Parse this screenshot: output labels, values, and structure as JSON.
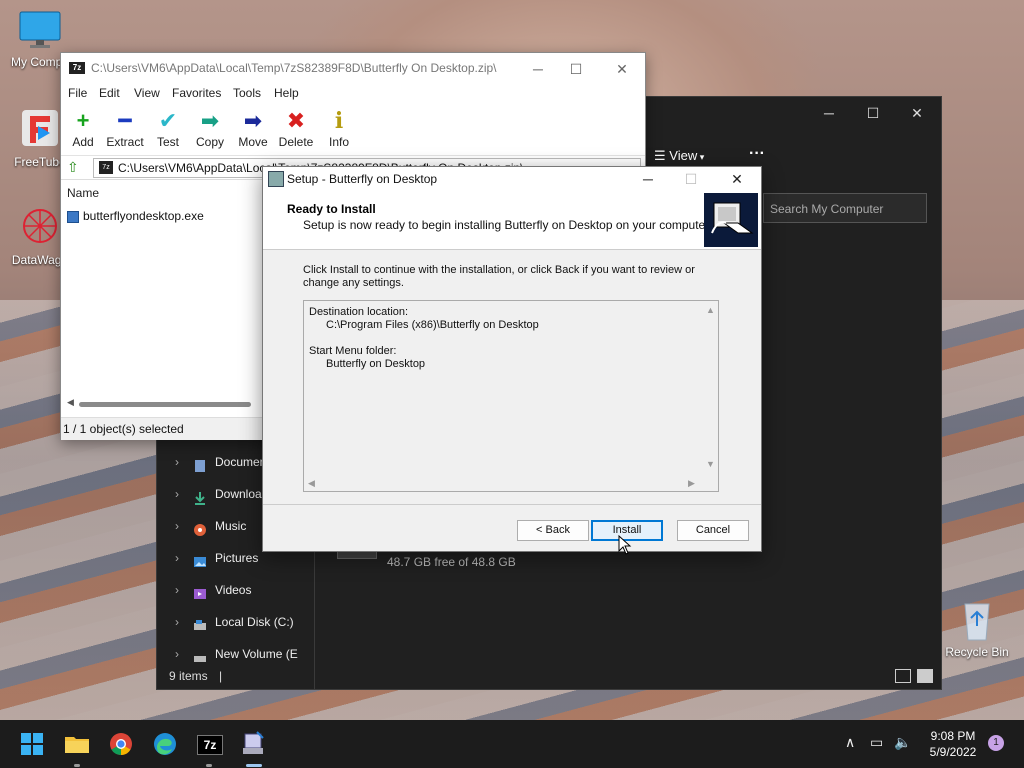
{
  "desktop": {
    "icons": [
      {
        "label": "My Compu"
      },
      {
        "label": "FreeTube"
      },
      {
        "label": "DataWago"
      }
    ],
    "recycle_bin": "Recycle Bin"
  },
  "explorer": {
    "view_label": "View",
    "more_label": "···",
    "search_placeholder": "Search My Computer",
    "sidebar": [
      {
        "label": "Documen"
      },
      {
        "label": "Downloa"
      },
      {
        "label": "Music"
      },
      {
        "label": "Pictures"
      },
      {
        "label": "Videos"
      },
      {
        "label": "Local Disk (C:)"
      },
      {
        "label": "New Volume (E"
      }
    ],
    "disk_free": "48.7 GB free of 48.8 GB",
    "status": "9 items",
    "colors": {
      "bg": "#202020"
    }
  },
  "zip": {
    "logo": "7z",
    "title": "C:\\Users\\VM6\\AppData\\Local\\Temp\\7zS82389F8D\\Butterfly On Desktop.zip\\",
    "menu": [
      "File",
      "Edit",
      "View",
      "Favorites",
      "Tools",
      "Help"
    ],
    "tools": [
      {
        "label": "Add",
        "icon": "plus-icon",
        "glyph": "+",
        "color": "#17a31e"
      },
      {
        "label": "Extract",
        "icon": "minus-icon",
        "glyph": "━",
        "color": "#1b3bbf"
      },
      {
        "label": "Test",
        "icon": "check-icon",
        "glyph": "✔",
        "color": "#2bb7c9"
      },
      {
        "label": "Copy",
        "icon": "copy-arrow-icon",
        "glyph": "➡",
        "color": "#18a086"
      },
      {
        "label": "Move",
        "icon": "move-arrow-icon",
        "glyph": "➡",
        "color": "#1b2a9a"
      },
      {
        "label": "Delete",
        "icon": "delete-x-icon",
        "glyph": "✖",
        "color": "#d8201f"
      },
      {
        "label": "Info",
        "icon": "info-icon",
        "glyph": "i",
        "color": "#b59c10"
      }
    ],
    "address": "C:\\Users\\VM6\\AppData\\Local\\Temp\\7zS82389F8D\\Butterfly On Desktop.zip\\",
    "column_name": "Name",
    "file": "butterflyondesktop.exe",
    "status": "1 / 1 object(s) selected"
  },
  "setup": {
    "title": "Setup - Butterfly on Desktop",
    "heading": "Ready to Install",
    "subheading": "Setup is now ready to begin installing Butterfly on Desktop on your computer.",
    "intro": "Click Install to continue with the installation, or click Back if you want to review or change any settings.",
    "memo": {
      "dest_label": "Destination location:",
      "dest_value": "C:\\Program Files (x86)\\Butterfly on Desktop",
      "start_label": "Start Menu folder:",
      "start_value": "Butterfly on Desktop"
    },
    "buttons": {
      "back": "< Back",
      "install": "Install",
      "cancel": "Cancel"
    }
  },
  "taskbar": {
    "time": "9:08 PM",
    "date": "5/9/2022",
    "notifications": "1"
  }
}
